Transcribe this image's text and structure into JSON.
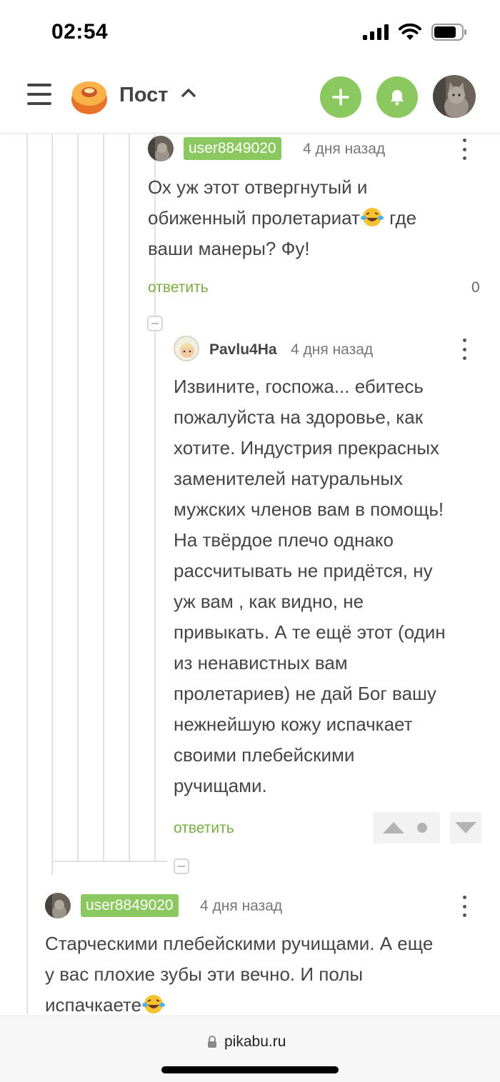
{
  "status_bar": {
    "time": "02:54"
  },
  "header": {
    "title": "Пост"
  },
  "comments": [
    {
      "username": "user8849020",
      "time": "4 дня назад",
      "text_lines": [
        "Ох уж этот отвергнутый и",
        "обиженный пролетариат",
        "ваши манеры? Фу!"
      ],
      "inline_after_line2": "где",
      "reply_label": "ответить",
      "rating": "0"
    },
    {
      "username": "Pavlu4Ha",
      "time": "4 дня назад",
      "text_lines": [
        "Извините, госпожа... ебитесь",
        "пожалуйста на здоровье, как",
        "хотите. Индустрия прекрасных",
        "заменителей натуральных",
        "мужских членов вам в помощь!",
        "На твёрдое плечо однако",
        "рассчитывать не придётся, ну",
        "уж вам , как видно, не",
        "привыкать. А те ещё этот (один",
        "из ненавистных вам",
        "пролетариев) не дай Бог вашу",
        "нежнейшую кожу испачкает",
        "своими плебейскими",
        "ручищами."
      ],
      "reply_label": "ответить"
    },
    {
      "username": "user8849020",
      "time": "4 дня назад",
      "text_lines": [
        "Старческими плебейскими ручищами. А еще",
        "у вас плохие зубы эти вечно. И полы",
        "испачкаете"
      ]
    }
  ],
  "browser": {
    "url": "pikabu.ru"
  },
  "colors": {
    "accent_green": "#8cc860",
    "reply_green": "#7aac43"
  }
}
